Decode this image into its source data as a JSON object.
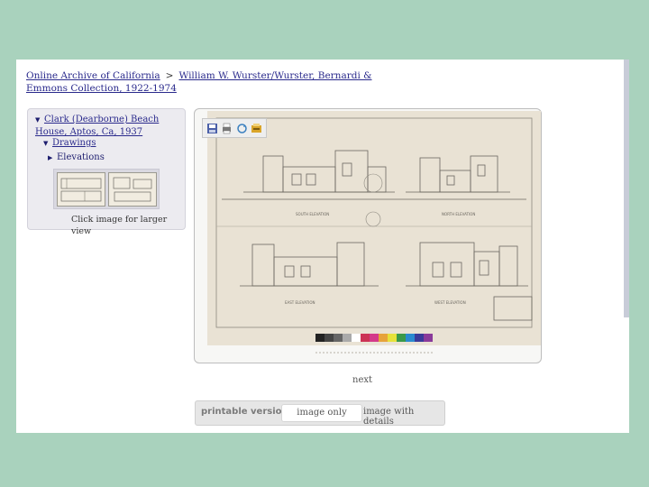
{
  "breadcrumb": {
    "root_link": "Online Archive of California",
    "separator": ">",
    "collection_link": "William W. Wurster/Wurster, Bernardi & Emmons Collection, 1922-1974"
  },
  "tree": {
    "house": "Clark (Dearborne) Beach House, Aptos, Ca, 1937",
    "drawings": "Drawings",
    "elevations": "Elevations",
    "hint": "Click image for larger view"
  },
  "viewer": {
    "drawing_labels": {
      "south_elevation": "SOUTH ELEVATION",
      "north_elevation": "NORTH ELEVATION",
      "east_elevation": "EAST ELEVATION",
      "west_elevation": "WEST ELEVATION"
    },
    "color_chip_colors": [
      "#222222",
      "#444444",
      "#666666",
      "#aaaaaa",
      "#ffffff",
      "#cc3355",
      "#d43a8a",
      "#e7a33a",
      "#e6e23a",
      "#3a9a4a",
      "#2a8ad0",
      "#3a3a9a",
      "#8a3a9a"
    ],
    "tools": [
      "save-icon",
      "print-icon",
      "rotate-icon",
      "reset-icon"
    ]
  },
  "nav": {
    "next": "next"
  },
  "view_bar": {
    "label": "printable version",
    "image_only": "image only",
    "image_with_details": "image with details"
  },
  "colors": {
    "background": "#a9d2bd",
    "link": "#2a2a8c",
    "panel": "#ecebf0"
  }
}
